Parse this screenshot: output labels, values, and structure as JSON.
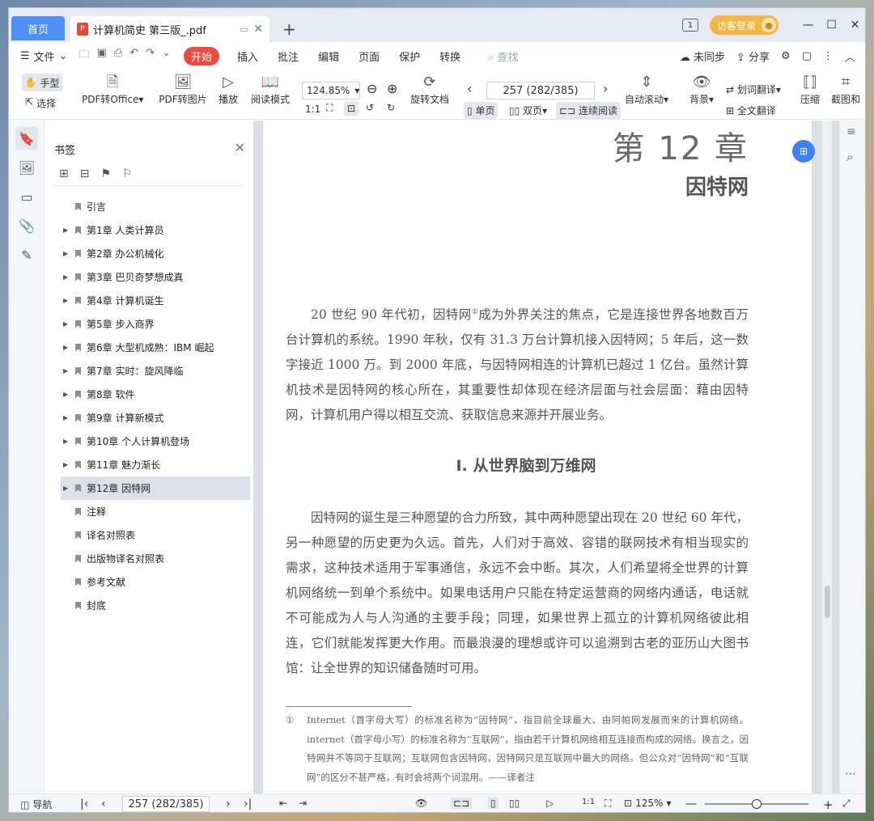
{
  "tabs": {
    "home": "首页",
    "document": "计算机简史 第三版_.pdf",
    "new_tab": "+"
  },
  "titlebar": {
    "badge": "1",
    "login": "访客登录"
  },
  "menu": {
    "file": "文件",
    "start": "开始",
    "items": [
      "插入",
      "批注",
      "编辑",
      "页面",
      "保护",
      "转换"
    ],
    "search": "查找",
    "unsynced": "未同步",
    "share": "分享"
  },
  "toolbar": {
    "hand": "手型",
    "select": "选择",
    "to_office": "PDF转Office",
    "to_image": "PDF转图片",
    "play": "播放",
    "read_mode": "阅读模式",
    "zoom": "124.85%",
    "rotate": "旋转文档",
    "page": "257 (282/385)",
    "single": "单页",
    "double": "双页",
    "continuous": "连续阅读",
    "autoscroll": "自动滚动",
    "background": "背景",
    "word_translate": "划词翻译",
    "full_translate": "全文翻译",
    "compress": "压缩",
    "screenshot": "截图和"
  },
  "bookmarks": {
    "title": "书签",
    "items": [
      {
        "label": "引言",
        "expandable": false
      },
      {
        "label": "第1章 人类计算员",
        "expandable": true
      },
      {
        "label": "第2章 办公机械化",
        "expandable": true
      },
      {
        "label": "第3章 巴贝奇梦想成真",
        "expandable": true
      },
      {
        "label": "第4章 计算机诞生",
        "expandable": true
      },
      {
        "label": "第5章 步入商界",
        "expandable": true
      },
      {
        "label": "第6章 大型机成熟：IBM 崛起",
        "expandable": true
      },
      {
        "label": "第7章 实时：旋风降临",
        "expandable": true
      },
      {
        "label": "第8章 软件",
        "expandable": true
      },
      {
        "label": "第9章 计算新模式",
        "expandable": true
      },
      {
        "label": "第10章 个人计算机登场",
        "expandable": true
      },
      {
        "label": "第11章 魅力渐长",
        "expandable": true
      },
      {
        "label": "第12章 因特网",
        "expandable": true,
        "active": true
      },
      {
        "label": "注释",
        "expandable": false
      },
      {
        "label": "译名对照表",
        "expandable": false
      },
      {
        "label": "出版物译名对照表",
        "expandable": false
      },
      {
        "label": "参考文献",
        "expandable": false
      },
      {
        "label": "封底",
        "expandable": false
      }
    ]
  },
  "page": {
    "chapter_number": "第 12 章",
    "chapter_title": "因特网",
    "para1_a": "20 世纪 90 年代初，因特网",
    "para1_sup": "①",
    "para1_b": "成为外界关注的焦点，它是连接世界各地数百万台计算机的系统。1990 年秋，仅有 31.3 万台计算机接入因特网；5 年后，这一数字接近 1000 万。到 2000 年底，与因特网相连的计算机已超过 1 亿台。虽然计算机技术是因特网的核心所在，其重要性却体现在经济层面与社会层面：藉由因特网，计算机用户得以相互交流、获取信息来源并开展业务。",
    "section_title": "I. 从世界脑到万维网",
    "para2": "因特网的诞生是三种愿望的合力所致，其中两种愿望出现在 20 世纪 60 年代，另一种愿望的历史更为久远。首先，人们对于高效、容错的联网技术有相当现实的需求，这种技术适用于军事通信，永远不会中断。其次，人们希望将全世界的计算机网络统一到单个系统中。如果电话用户只能在特定运营商的网络内通话，电话就不可能成为人与人沟通的主要手段；同理，如果世界上孤立的计算机网络彼此相连，它们就能发挥更大作用。而最浪漫的理想或许可以追溯到古老的亚历山大图书馆：让全世界的知识储备随时可用。",
    "footnote_mark": "①",
    "footnote": "Internet（首字母大写）的标准名称为“因特网”，指目前全球最大、由阿帕网发展而来的计算机网络。internet（首字母小写）的标准名称为“互联网”，指由若干计算机网络相互连接而构成的网络。换言之，因特网并不等同于互联网；互联网包含因特网，因特网只是互联网中最大的网络。但公众对“因特网”和“互联网”的区分不甚严格，有时会将两个词混用。——译者注"
  },
  "status": {
    "nav": "导航",
    "page": "257 (282/385)",
    "zoom": "125%",
    "zoom_fraction": 0.5
  },
  "colors": {
    "accent": "#4e8ef7",
    "start": "#ef4b3c",
    "login": "#f7b642"
  }
}
